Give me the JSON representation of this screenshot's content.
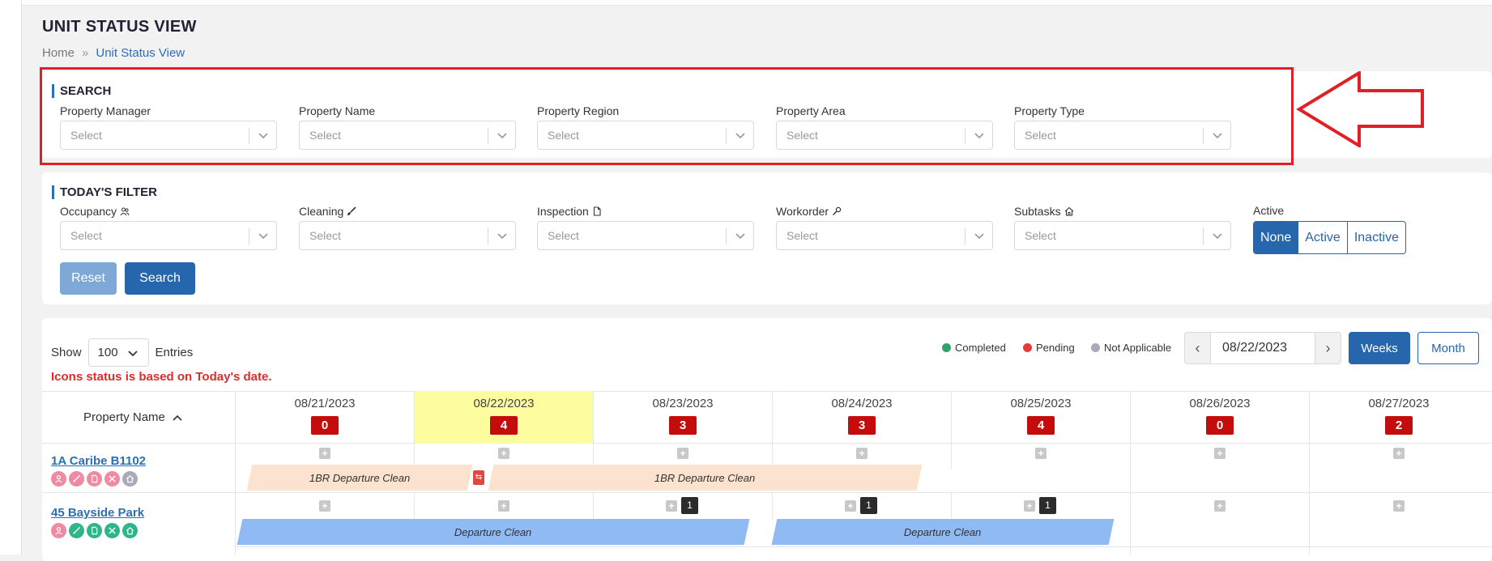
{
  "page": {
    "title": "UNIT STATUS VIEW"
  },
  "breadcrumb": {
    "home": "Home",
    "separator": "»",
    "current": "Unit Status View"
  },
  "search": {
    "title": "SEARCH",
    "fields": [
      {
        "label": "Property Manager",
        "placeholder": "Select"
      },
      {
        "label": "Property Name",
        "placeholder": "Select"
      },
      {
        "label": "Property Region",
        "placeholder": "Select"
      },
      {
        "label": "Property Area",
        "placeholder": "Select"
      },
      {
        "label": "Property Type",
        "placeholder": "Select"
      }
    ]
  },
  "filter": {
    "title": "TODAY'S FILTER",
    "fields": [
      {
        "label": "Occupancy",
        "placeholder": "Select",
        "icon": "people-icon"
      },
      {
        "label": "Cleaning",
        "placeholder": "Select",
        "icon": "brush-icon"
      },
      {
        "label": "Inspection",
        "placeholder": "Select",
        "icon": "document-icon"
      },
      {
        "label": "Workorder",
        "placeholder": "Select",
        "icon": "wrench-icon"
      },
      {
        "label": "Subtasks",
        "placeholder": "Select",
        "icon": "home-icon"
      }
    ],
    "active": {
      "label": "Active",
      "options": [
        "None",
        "Active",
        "Inactive"
      ],
      "selected": "None"
    },
    "reset_label": "Reset",
    "search_label": "Search"
  },
  "table": {
    "show_label": "Show",
    "entries_value": "100",
    "entries_label": "Entries",
    "status_note": "Icons status is based on Today's date.",
    "legend": [
      {
        "label": "Completed",
        "color": "#2fa36b"
      },
      {
        "label": "Pending",
        "color": "#e83a3a"
      },
      {
        "label": "Not Applicable",
        "color": "#a9a9b8"
      }
    ],
    "current_date": "08/22/2023",
    "prev_label": "‹",
    "next_label": "›",
    "weeks_label": "Weeks",
    "month_label": "Month",
    "property_header": "Property Name",
    "days": [
      {
        "date": "08/21/2023",
        "count": "0"
      },
      {
        "date": "08/22/2023",
        "count": "4"
      },
      {
        "date": "08/23/2023",
        "count": "3"
      },
      {
        "date": "08/24/2023",
        "count": "3"
      },
      {
        "date": "08/25/2023",
        "count": "4"
      },
      {
        "date": "08/26/2023",
        "count": "0"
      },
      {
        "date": "08/27/2023",
        "count": "2"
      }
    ],
    "rows": [
      {
        "name": "1A Caribe B1102",
        "bars": [
          "1BR Departure Clean",
          "1BR Departure Clean"
        ],
        "badges": []
      },
      {
        "name": "45 Bayside Park",
        "bars": [
          "Departure Clean",
          "Departure Clean"
        ],
        "badges": [
          "1",
          "1",
          "1"
        ]
      }
    ]
  },
  "colors": {
    "accent": "#2566ad",
    "highlight": "#e21f26",
    "count_badge": "#c40c0c",
    "today": "#fdfda0",
    "pink_icon": "#f08aa3",
    "green_icon": "#2fb58a"
  },
  "plus_label": "+",
  "swap_label": "⇆"
}
